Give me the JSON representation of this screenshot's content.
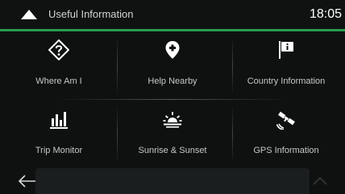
{
  "header": {
    "title": "Useful Information",
    "clock": "18:05"
  },
  "tiles": [
    {
      "label": "Where Am I",
      "icon": "where-am-i-icon"
    },
    {
      "label": "Help Nearby",
      "icon": "help-nearby-icon"
    },
    {
      "label": "Country Information",
      "icon": "country-information-icon"
    },
    {
      "label": "Trip Monitor",
      "icon": "trip-monitor-icon"
    },
    {
      "label": "Sunrise & Sunset",
      "icon": "sunrise-sunset-icon"
    },
    {
      "label": "GPS Information",
      "icon": "gps-information-icon"
    }
  ],
  "footer": {
    "back_icon": "back-arrow-icon",
    "up_icon": "chevron-up-icon"
  },
  "colors": {
    "background": "#0f1111",
    "accent": "#2a9b50",
    "text": "#c4c8c8",
    "icon": "#ffffff"
  }
}
